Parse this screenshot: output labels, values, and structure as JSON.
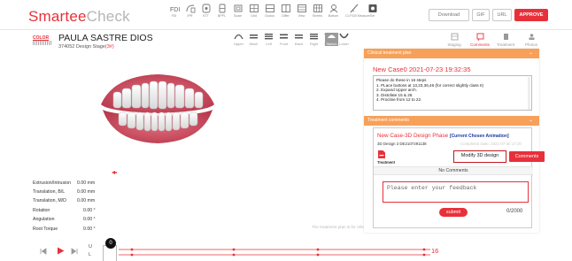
{
  "app": {
    "logo_part1": "Smartee",
    "logo_part2": "Check"
  },
  "toolbar": {
    "tools": [
      "FDI",
      "IPR",
      "KTT",
      "BPPL",
      "Scale",
      "Grid",
      "Occlus",
      "Differ",
      "View",
      "Sheets",
      "Bottom",
      "CLF/CB Measure",
      "Set"
    ],
    "download": "Download",
    "gif": "GIF",
    "url": "URL",
    "approve": "APPROVE"
  },
  "patient": {
    "logo_text": "COLOR",
    "name": "PAULA SASTRE DIOS",
    "id_stage": "374052 Design Stage",
    "stage_num": "(3#)"
  },
  "views": [
    "Upper",
    "Mesh",
    "Left",
    "Front",
    "Back",
    "Right",
    "Mand",
    "Lower",
    "Sketch"
  ],
  "right_tabs": [
    "Staging",
    "Comments",
    "Treatment",
    "Photos"
  ],
  "measurements": [
    {
      "label": "Extrusion/Intrusion",
      "value": "0.00 mm"
    },
    {
      "label": "Translation, B/L",
      "value": "0.00 mm"
    },
    {
      "label": "Translation, M/D",
      "value": "0.00 mm"
    },
    {
      "label": "Rotation",
      "value": "0.00 °"
    },
    {
      "label": "Angulation",
      "value": "0.00 °"
    },
    {
      "label": "Root Torque",
      "value": "0.00 °"
    }
  ],
  "timeline": {
    "current_step": "0",
    "end_step": "16",
    "row_upper": "U",
    "row_lower": "L"
  },
  "panel": {
    "plan_header": "Clinical treatment plan",
    "case_title": "New Case0 2021-07-23 19:32:35",
    "plan_lines": [
      "Please do these in 16 steps",
      "1. PLace buttons at 13,23,36,46 (for correct slightly class II)",
      "2. Expand Upper arch.",
      "3. Distofate 15 & 26.",
      "4. Procline from 12 to 22."
    ],
    "comments_header": "Treatment comments",
    "comment_title": "New Case-3D Design Phase",
    "comment_chosen": "[Current Chosen Animation]",
    "design_label": "3D Design 2 DE2107291138",
    "date_text": "Completed Date: 2021-07-30 17:20",
    "treatment_label": "Treatment",
    "modify_label": "Modify 3D design",
    "comments_label": "Comments",
    "no_comments": "No Comments",
    "feedback_placeholder": "Please enter your feedback",
    "submit_label": "submit",
    "char_count": "0/2000"
  },
  "hint": "The treatment plan is for reference only and the actual results may vary.",
  "colors": {
    "accent": "#e8303a",
    "panel_header": "#f7a05a",
    "blue": "#1a3aa0"
  }
}
